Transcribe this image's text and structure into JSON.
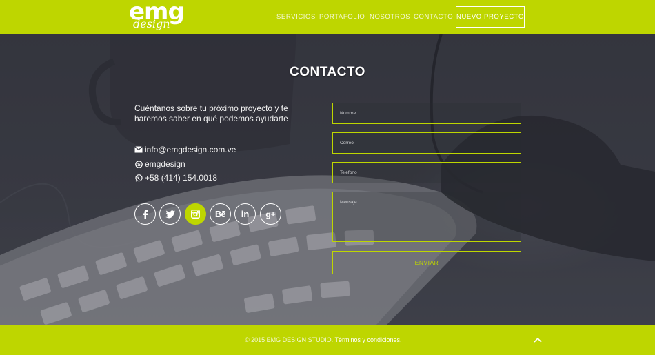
{
  "logo": {
    "main": "emg",
    "sub": "design"
  },
  "nav": {
    "items": [
      "SERVICIOS",
      "PORTAFOLIO",
      "NOSOTROS",
      "CONTACTO"
    ],
    "cta": "NUEVO PROYECTO"
  },
  "contact": {
    "title": "CONTACTO",
    "intro": "Cuéntanos sobre tu próximo proyecto y te haremos saber en qué podemos ayudarte",
    "email": "info@emgdesign.com.ve",
    "skype": "emgdesign",
    "phone": "+58 (414) 154.0018",
    "social": [
      "facebook-icon",
      "twitter-icon",
      "instagram-icon",
      "behance-icon",
      "linkedin-icon",
      "google-plus-icon"
    ]
  },
  "form": {
    "name_placeholder": "Nombre",
    "email_placeholder": "Correo",
    "phone_placeholder": "Teléfono",
    "message_placeholder": "Mensaje",
    "submit": "ENVIAR"
  },
  "footer": {
    "copyright": "© 2015 EMG DESIGN STUDIO.",
    "terms": "Términos y condiciones."
  },
  "colors": {
    "brand": "#bed600",
    "overlay": "#3a3c45"
  }
}
